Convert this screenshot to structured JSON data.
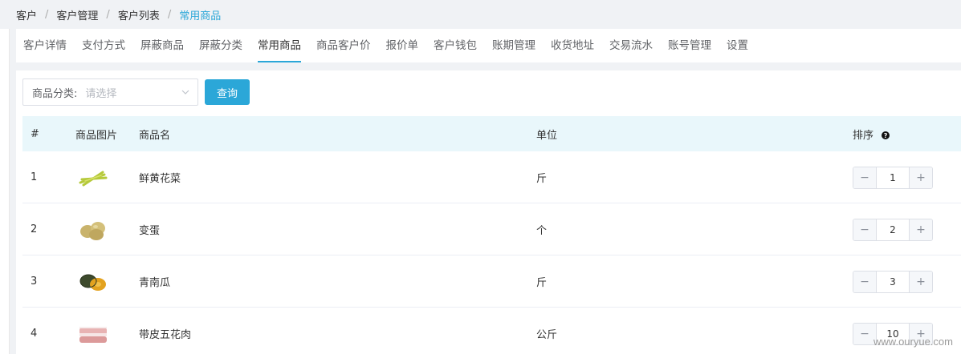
{
  "breadcrumb": [
    {
      "label": "客户"
    },
    {
      "label": "客户管理"
    },
    {
      "label": "客户列表"
    },
    {
      "label": "常用商品"
    }
  ],
  "tabs": [
    {
      "label": "客户详情"
    },
    {
      "label": "支付方式"
    },
    {
      "label": "屏蔽商品"
    },
    {
      "label": "屏蔽分类"
    },
    {
      "label": "常用商品"
    },
    {
      "label": "商品客户价"
    },
    {
      "label": "报价单"
    },
    {
      "label": "客户钱包"
    },
    {
      "label": "账期管理"
    },
    {
      "label": "收货地址"
    },
    {
      "label": "交易流水"
    },
    {
      "label": "账号管理"
    },
    {
      "label": "设置"
    }
  ],
  "active_tab": "常用商品",
  "filter": {
    "label": "商品分类:",
    "placeholder": "请选择"
  },
  "query_button": "查询",
  "table": {
    "headers": {
      "num": "#",
      "image": "商品图片",
      "name": "商品名",
      "unit": "单位",
      "sort": "排序"
    },
    "rows": [
      {
        "num": "1",
        "name": "鲜黄花菜",
        "unit": "斤",
        "sort": "1",
        "icon": "daylily-image"
      },
      {
        "num": "2",
        "name": "变蛋",
        "unit": "个",
        "sort": "2",
        "icon": "preserved-egg-image"
      },
      {
        "num": "3",
        "name": "青南瓜",
        "unit": "斤",
        "sort": "3",
        "icon": "green-pumpkin-image"
      },
      {
        "num": "4",
        "name": "带皮五花肉",
        "unit": "公斤",
        "sort": "10",
        "icon": "pork-belly-image"
      }
    ]
  },
  "stepper": {
    "minus": "−",
    "plus": "+"
  },
  "watermark": "www.ouryue.com",
  "colors": {
    "accent": "#2ba7d8",
    "header_bg": "#e9f7fb"
  }
}
